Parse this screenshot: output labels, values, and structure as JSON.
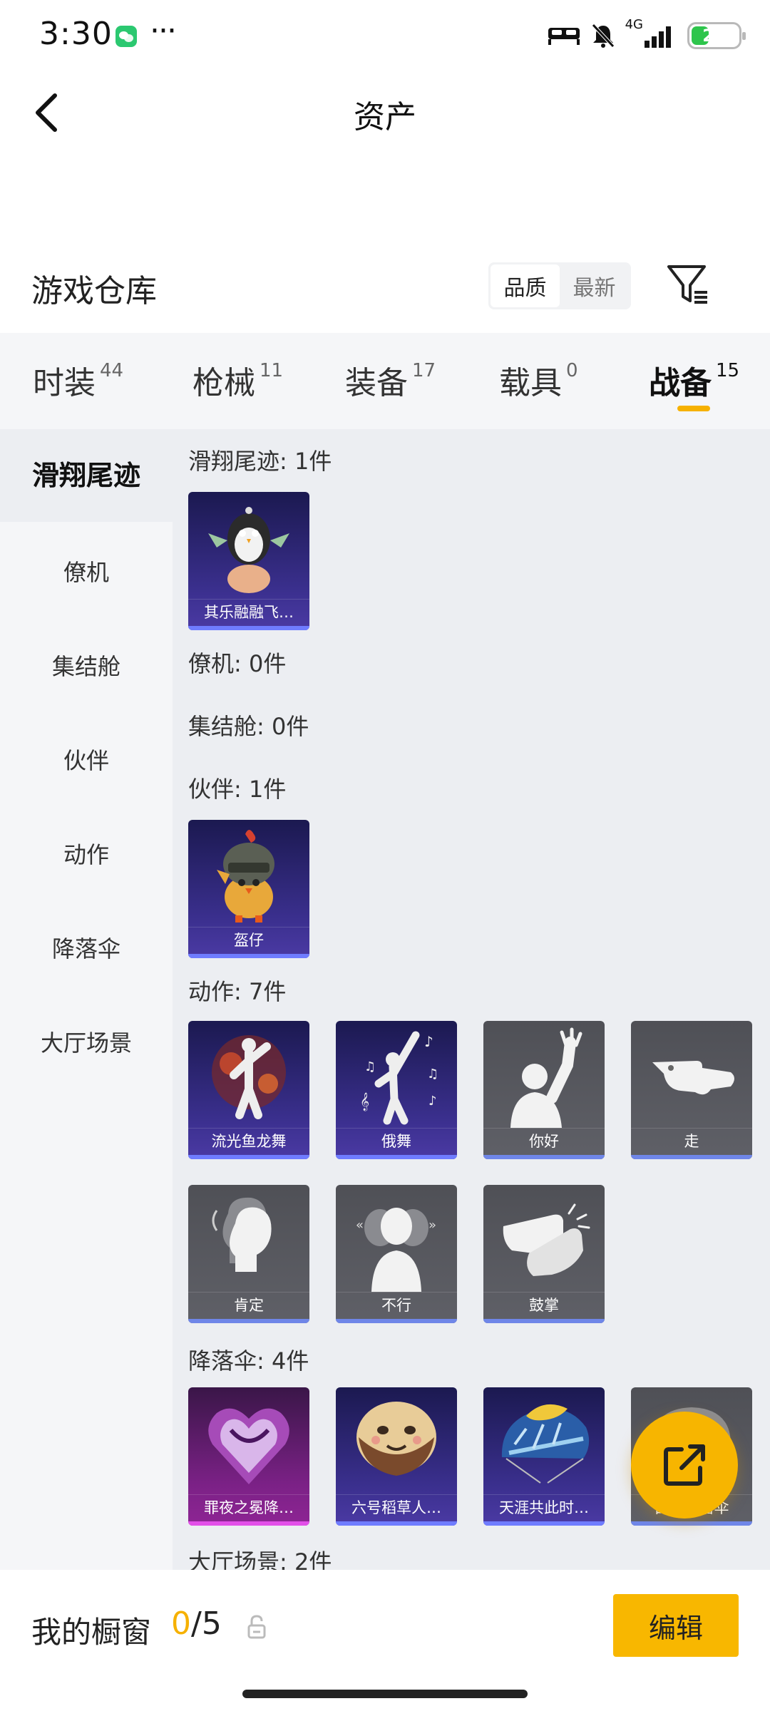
{
  "status_bar": {
    "time": "3:30",
    "network": "4G",
    "battery": "21"
  },
  "header": {
    "title": "资产"
  },
  "warehouse": {
    "title": "游戏仓库",
    "sort_options": [
      "品质",
      "最新"
    ],
    "active_sort": "品质"
  },
  "tabs": [
    {
      "label": "时装",
      "count": "44"
    },
    {
      "label": "枪械",
      "count": "11"
    },
    {
      "label": "装备",
      "count": "17"
    },
    {
      "label": "载具",
      "count": "0"
    },
    {
      "label": "战备",
      "count": "15"
    }
  ],
  "active_tab": "战备",
  "sidebar": {
    "items": [
      "滑翔尾迹",
      "僚机",
      "集结舱",
      "伙伴",
      "动作",
      "降落伞",
      "大厅场景"
    ],
    "active": "滑翔尾迹"
  },
  "sections": [
    {
      "label": "滑翔尾迹: 1件",
      "items": [
        {
          "name": "其乐融融飞…",
          "rarity": "purple",
          "icon": "penguin-glider-icon"
        }
      ]
    },
    {
      "label": "僚机: 0件",
      "items": []
    },
    {
      "label": "集结舱: 0件",
      "items": []
    },
    {
      "label": "伙伴: 1件",
      "items": [
        {
          "name": "盔仔",
          "rarity": "purple",
          "icon": "helmet-chick-icon"
        }
      ]
    },
    {
      "label": "动作: 7件",
      "items": [
        {
          "name": "流光鱼龙舞",
          "rarity": "purple",
          "icon": "dragon-dance-icon"
        },
        {
          "name": "俄舞",
          "rarity": "purple",
          "icon": "ballet-dance-icon"
        },
        {
          "name": "你好",
          "rarity": "gray",
          "icon": "wave-hello-icon"
        },
        {
          "name": "走",
          "rarity": "gray",
          "icon": "pointing-hand-icon"
        },
        {
          "name": "肯定",
          "rarity": "gray",
          "icon": "nod-head-icon"
        },
        {
          "name": "不行",
          "rarity": "gray",
          "icon": "shake-head-icon"
        },
        {
          "name": "鼓掌",
          "rarity": "gray",
          "icon": "clapping-hands-icon"
        }
      ]
    },
    {
      "label": "降落伞: 4件",
      "items": [
        {
          "name": "罪夜之冕降…",
          "rarity": "pink",
          "icon": "heart-parachute-icon"
        },
        {
          "name": "六号稻草人…",
          "rarity": "purple",
          "icon": "scarecrow-parachute-icon"
        },
        {
          "name": "天涯共此时…",
          "rarity": "purple",
          "icon": "balloon-parachute-icon"
        },
        {
          "name": "白色降落伞",
          "rarity": "gray",
          "icon": "parachute-icon"
        }
      ]
    },
    {
      "label": "大厅场景: 2件",
      "items": []
    }
  ],
  "bottom_bar": {
    "showcase_label": "我的橱窗",
    "showcase_current": "0",
    "showcase_total": "/5",
    "edit_label": "编辑"
  },
  "colors": {
    "accent": "#f6b100",
    "purple_card": "#3a2f8d",
    "gray_card": "#55565c",
    "pink_card": "#7b2186"
  }
}
